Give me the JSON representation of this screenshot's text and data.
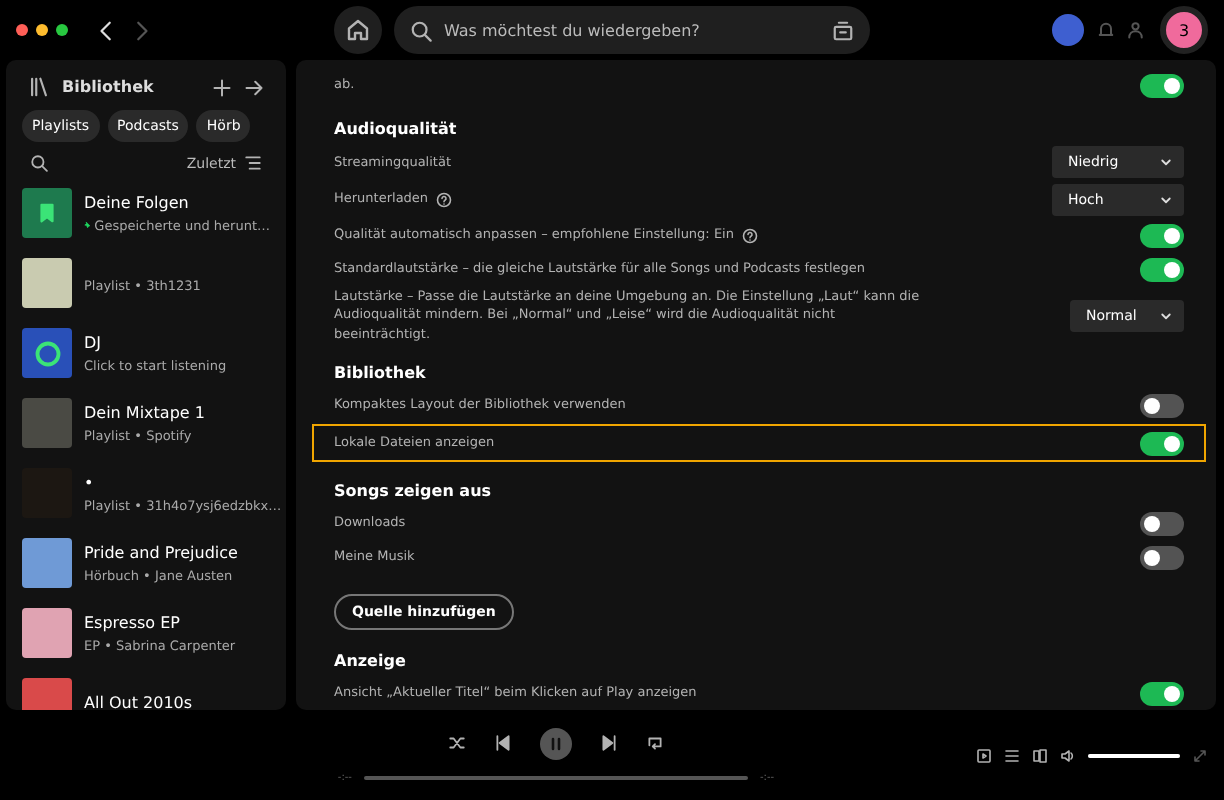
{
  "topbar": {
    "search": {
      "placeholder": "Was möchtest du wiedergeben?"
    },
    "avatar": "3"
  },
  "sidebar": {
    "title": "Bibliothek",
    "filters": [
      {
        "label": "Playlists",
        "selected": false
      },
      {
        "label": "Podcasts",
        "selected": false
      },
      {
        "label": "Hörb",
        "selected": false
      }
    ],
    "sort": "Zuletzt",
    "items": [
      {
        "title": "Deine Folgen",
        "subtitle": "Gespeicherte und herunt…",
        "kind": "saved",
        "pinned": true,
        "color": "#1e7a4e"
      },
      {
        "subtitle": "Playlist • 3th1231",
        "kind": "cover",
        "pinned": false,
        "color": "#c9cbb0"
      },
      {
        "title": "DJ",
        "subtitle": "Click to start listening",
        "kind": "dj",
        "pinned": false,
        "color": "#2950b8"
      },
      {
        "title": "Dein Mixtape 1",
        "subtitle": "Playlist • Spotify",
        "kind": "cover",
        "pinned": false,
        "color": "#4a4a44"
      },
      {
        "title": "•",
        "subtitle": "Playlist • 31h4o7ysj6edzbkx…",
        "kind": "cover",
        "pinned": false,
        "color": "#1c1712"
      },
      {
        "title": "Pride and Prejudice",
        "subtitle": "Hörbuch • Jane Austen",
        "kind": "cover",
        "pinned": false,
        "color": "#6f9ad6"
      },
      {
        "title": "Espresso EP",
        "subtitle": "EP • Sabrina Carpenter",
        "kind": "cover",
        "pinned": false,
        "color": "#e0a3b2"
      },
      {
        "title": "All Out 2010s",
        "kind": "cover",
        "pinned": false,
        "color": "#d94a4a"
      }
    ]
  },
  "settings": [
    {
      "kind": "toggle",
      "label": "ab.",
      "on": true,
      "highlighted": false
    },
    {
      "kind": "heading",
      "label": "Audioqualität"
    },
    {
      "kind": "select",
      "label": "Streamingqualität",
      "value": "Niedrig",
      "help": false
    },
    {
      "kind": "select",
      "label": "Herunterladen",
      "value": "Hoch",
      "help": true
    },
    {
      "kind": "toggle",
      "label": "Qualität automatisch anpassen – empfohlene Einstellung: Ein",
      "help": true,
      "on": true,
      "highlighted": false
    },
    {
      "kind": "toggle",
      "label": "Standardlautstärke – die gleiche Lautstärke für alle Songs und Podcasts festlegen",
      "on": true,
      "highlighted": false
    },
    {
      "kind": "select",
      "label": "Lautstärke – Passe die Lautstärke an deine Umgebung an. Die Einstellung „Laut“ kann die Audioqualität mindern. Bei „Normal“ und „Leise“ wird die Audioqualität nicht beeinträchtigt.",
      "value": "Normal",
      "help": false
    },
    {
      "kind": "heading",
      "label": "Bibliothek"
    },
    {
      "kind": "toggle",
      "label": "Kompaktes Layout der Bibliothek verwenden",
      "on": false,
      "highlighted": false
    },
    {
      "kind": "toggle",
      "label": "Lokale Dateien anzeigen",
      "on": true,
      "highlighted": true
    },
    {
      "kind": "heading",
      "label": "Songs zeigen aus"
    },
    {
      "kind": "toggle",
      "label": "Downloads",
      "on": false,
      "highlighted": false
    },
    {
      "kind": "toggle",
      "label": "Meine Musik",
      "on": false,
      "highlighted": false
    },
    {
      "kind": "button",
      "label": "Quelle hinzufügen"
    },
    {
      "kind": "heading",
      "label": "Anzeige"
    },
    {
      "kind": "toggle",
      "label": "Ansicht „Aktueller Titel“ beim Klicken auf Play anzeigen",
      "on": true,
      "highlighted": false
    }
  ],
  "player": {
    "elapsed": "-:--",
    "remaining": "-:--",
    "progress": {
      "level": 0
    },
    "volume": {
      "level": 1
    }
  }
}
